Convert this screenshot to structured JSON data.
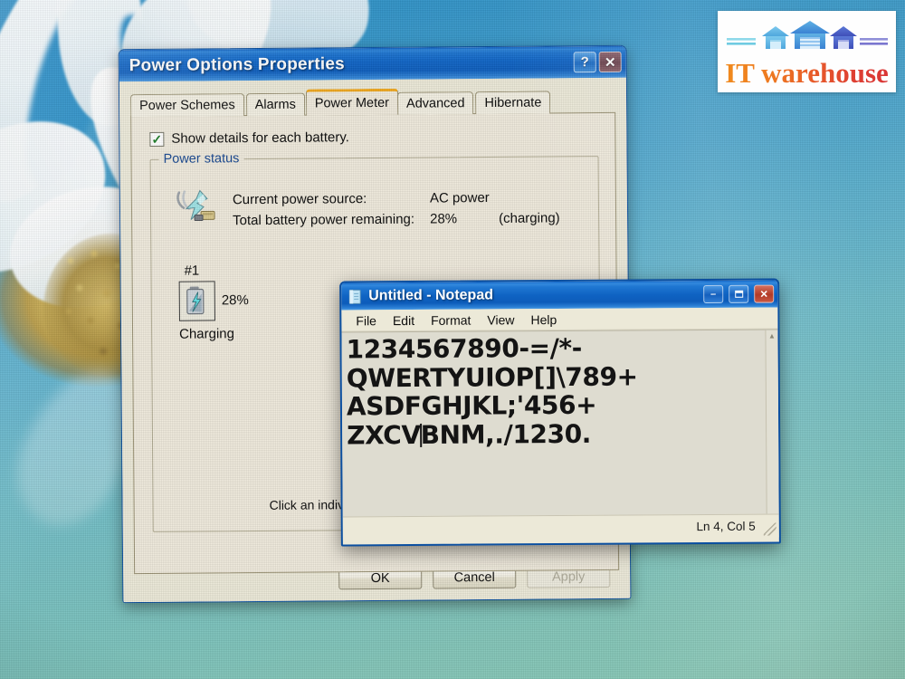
{
  "desktop": {
    "wallpaper_description": "daisy-flower-wallpaper"
  },
  "power_dialog": {
    "title": "Power Options Properties",
    "titlebar_buttons": [
      {
        "name": "help-button",
        "glyph": "?"
      },
      {
        "name": "close-button",
        "glyph": "✕"
      }
    ],
    "tabs": [
      {
        "label": "Power Schemes",
        "active": false
      },
      {
        "label": "Alarms",
        "active": false
      },
      {
        "label": "Power Meter",
        "active": true
      },
      {
        "label": "Advanced",
        "active": false
      },
      {
        "label": "Hibernate",
        "active": false
      }
    ],
    "checkbox": {
      "label": "Show details for each battery.",
      "checked": true,
      "check_glyph": "✓"
    },
    "group": {
      "legend": "Power status",
      "rows": [
        {
          "label": "Current power source:",
          "value": "AC power",
          "extra": ""
        },
        {
          "label": "Total battery power remaining:",
          "value": "28%",
          "extra": "(charging)"
        }
      ],
      "battery": {
        "number": "#1",
        "percent": "28%",
        "state": "Charging"
      },
      "hint": "Click an individual"
    },
    "buttons": [
      {
        "label": "OK",
        "enabled": true
      },
      {
        "label": "Cancel",
        "enabled": true
      },
      {
        "label": "Apply",
        "enabled": false
      }
    ]
  },
  "notepad": {
    "title": "Untitled - Notepad",
    "titlebar_buttons": [
      {
        "name": "minimize-button",
        "glyph": "–"
      },
      {
        "name": "maximize-button",
        "glyph": "❐"
      },
      {
        "name": "close-button",
        "glyph": "✕"
      }
    ],
    "menus": [
      "File",
      "Edit",
      "Format",
      "View",
      "Help"
    ],
    "lines": [
      "1234567890-=/*-",
      "QWERTYUIOP[]\\789+",
      "ASDFGHJKL;'456+"
    ],
    "line4_before_caret": "ZXCV",
    "line4_after_caret": "BNM,./1230.",
    "status": "Ln 4, Col 5"
  },
  "logo": {
    "text": "IT warehouse",
    "house_colors": [
      "#5bb4e5",
      "#3f8fd8",
      "#4a63c8"
    ],
    "text_gradient": [
      "#f08a1e",
      "#d93535"
    ]
  },
  "colors": {
    "xp_titlebar_blue": "#0f63c3",
    "xp_face": "#ece9d8",
    "active_tab_accent": "#f0a81e",
    "close_red": "#b23a26"
  }
}
